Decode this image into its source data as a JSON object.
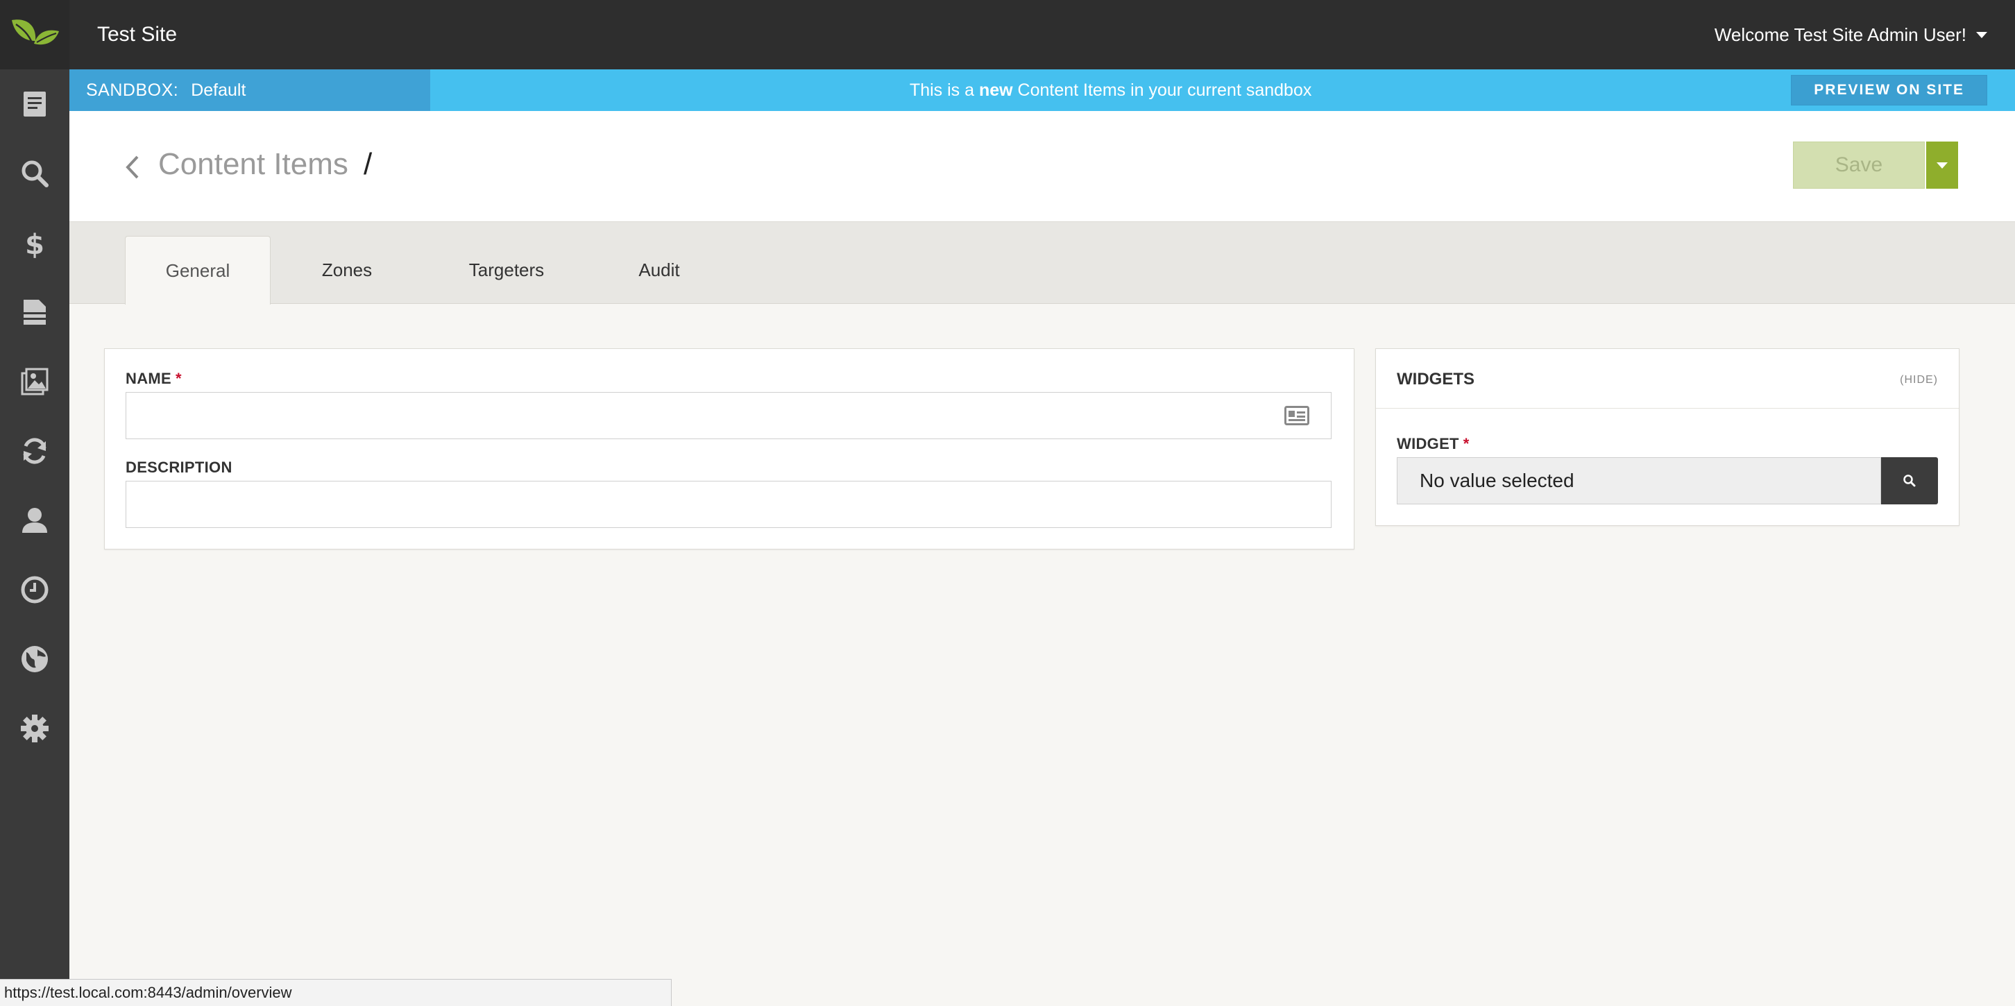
{
  "app": {
    "site_title": "Test Site",
    "user_greeting": "Welcome Test Site Admin User!"
  },
  "sidebar": {
    "logo_icon": "leaf-logo-icon",
    "items": [
      {
        "icon": "document-icon"
      },
      {
        "icon": "search-icon"
      },
      {
        "icon": "dollar-icon"
      },
      {
        "icon": "page-stack-icon"
      },
      {
        "icon": "images-icon"
      },
      {
        "icon": "refresh-icon"
      },
      {
        "icon": "user-icon"
      },
      {
        "icon": "clock-icon"
      },
      {
        "icon": "globe-icon"
      },
      {
        "icon": "gear-icon"
      }
    ]
  },
  "sandbox": {
    "label": "SANDBOX:",
    "name": "Default",
    "message_prefix": "This is a ",
    "message_bold": "new",
    "message_suffix": " Content Items in your current sandbox",
    "preview_label": "PREVIEW ON SITE"
  },
  "header": {
    "title": "Content Items",
    "separator": "/",
    "save_label": "Save"
  },
  "tabs": [
    {
      "label": "General",
      "active": true
    },
    {
      "label": "Zones",
      "active": false
    },
    {
      "label": "Targeters",
      "active": false
    },
    {
      "label": "Audit",
      "active": false
    }
  ],
  "form": {
    "name_label": "NAME",
    "name_value": "",
    "description_label": "DESCRIPTION",
    "description_value": "",
    "required_marker": "*"
  },
  "widgets_panel": {
    "title": "WIDGETS",
    "hide_label": "(HIDE)",
    "widget_label": "WIDGET",
    "widget_value": "No value selected"
  },
  "status_bar": {
    "url": "https://test.local.com:8443/admin/overview"
  },
  "colors": {
    "sidebar_bg": "#3a3a3a",
    "topbar_bg": "#2e2e2e",
    "sandbox_bg": "#45c0ef",
    "accent_green": "#8fae2c",
    "required_red": "#c8102e"
  }
}
